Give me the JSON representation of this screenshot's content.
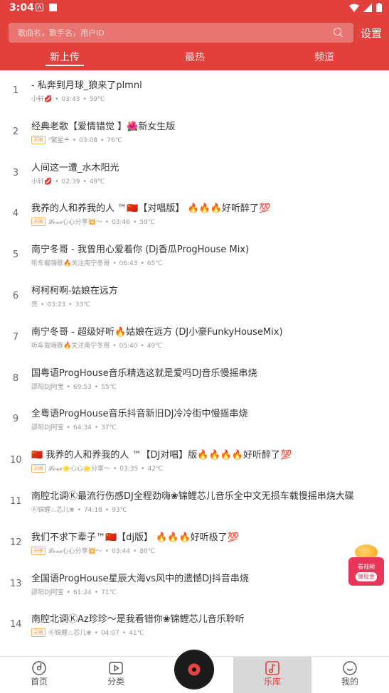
{
  "status": {
    "time": "3:04"
  },
  "search": {
    "placeholder": "歌曲名，歌手名，用户ID"
  },
  "header": {
    "settings_label": "设置"
  },
  "tabs": [
    {
      "label": "新上传",
      "active": true
    },
    {
      "label": "最热",
      "active": false
    },
    {
      "label": "频道",
      "active": false
    }
  ],
  "songs": [
    {
      "index": "1",
      "title": "- 私奔到月球_狼来了plmnl",
      "uploader": "小轩💋",
      "duration": "03:43",
      "temp": "59℃",
      "tag": ""
    },
    {
      "index": "2",
      "title": "经典老歌【爱情错觉 】🌺新女生版",
      "uploader": "⁰繁星☔",
      "duration": "03:08",
      "temp": "76℃",
      "tag": "天眼"
    },
    {
      "index": "3",
      "title": "人间这一遭_水木阳光",
      "uploader": "小轩💋",
      "duration": "02:39",
      "temp": "49℃",
      "tag": ""
    },
    {
      "index": "4",
      "title": "我养的人和养我的人 ™🇨🇳【对唱版】 🔥🔥🔥好听醉了💯",
      "uploader": "𝓛𝓸𝓿𝓮心心分享💥〜",
      "duration": "03:46",
      "temp": "59℃",
      "tag": "天眼"
    },
    {
      "index": "5",
      "title": "南宁冬哥 - 我曾用心爱着你 (Dj香瓜ProgHouse Mix)",
      "uploader": "听车载嗨歌🔥关注南宁冬哥",
      "duration": "06:43",
      "temp": "65℃",
      "tag": ""
    },
    {
      "index": "6",
      "title": "柯柯柯啊-姑娘在远方",
      "uploader": "亮",
      "duration": "03:23",
      "temp": "33℃",
      "tag": ""
    },
    {
      "index": "7",
      "title": "南宁冬哥 - 超级好听🔥姑娘在远方 (DJ小豪FunkyHouseMix)",
      "uploader": "听车载嗨歌🔥关注南宁冬哥",
      "duration": "05:40",
      "temp": "49℃",
      "tag": ""
    },
    {
      "index": "8",
      "title": "国粤语ProgHouse音乐精选这就是爱吗DJ音乐慢摇串烧",
      "uploader": "邵阳DJ阿宝",
      "duration": "69:53",
      "temp": "55℃",
      "tag": ""
    },
    {
      "index": "9",
      "title": "全粤语ProgHouse音乐抖音新旧DJ冷冷街中慢摇串烧",
      "uploader": "邵阳DJ阿宝",
      "duration": "64:34",
      "temp": "37℃",
      "tag": ""
    },
    {
      "index": "10",
      "title": "🇨🇳 我养的人和养我的人 ™【DJ对唱】版🔥🔥🔥🔥好听醉了💯",
      "uploader": "𝓛𝓸𝓿𝓮🌟心心🌟分享〜",
      "duration": "03:35",
      "temp": "42℃",
      "tag": "天眼"
    },
    {
      "index": "11",
      "title": "南腔北调Ⓚ最流行伤感DJ全程劲嗨❀锦鲤芯儿音乐全中文无损车载慢摇串烧大碟",
      "uploader": "Ⓚ锦鲤♨芯儿❀",
      "duration": "74:18",
      "temp": "93℃",
      "tag": ""
    },
    {
      "index": "12",
      "title": "我们不求下辈子™🇨🇳【dj版】 🔥🔥🔥好听极了💯",
      "uploader": "𝓛𝓸𝓿𝓮心心分享💥〜",
      "duration": "03:44",
      "temp": "80℃",
      "tag": "天眼"
    },
    {
      "index": "13",
      "title": "全国语ProgHouse星辰大海vs风中的遗憾DJ抖音串烧",
      "uploader": "邵阳DJ阿宝",
      "duration": "61:24",
      "temp": "71℃",
      "tag": ""
    },
    {
      "index": "14",
      "title": "南腔北调ⓀAz珍珍〜是我看错你❀锦鲤芯儿音乐聆听",
      "uploader": "Ⓚ锦鲤♨芯儿❀",
      "duration": "04:07",
      "temp": "41℃",
      "tag": "天眼"
    }
  ],
  "promo": {
    "line1": "看视频",
    "line2": "赚现金"
  },
  "bottom_nav": [
    {
      "label": "首页",
      "icon": "home-disc-icon"
    },
    {
      "label": "分类",
      "icon": "video-play-icon"
    },
    {
      "label": "乐库",
      "icon": "music-note-icon",
      "active": true
    },
    {
      "label": "我的",
      "icon": "profile-smile-icon"
    }
  ]
}
